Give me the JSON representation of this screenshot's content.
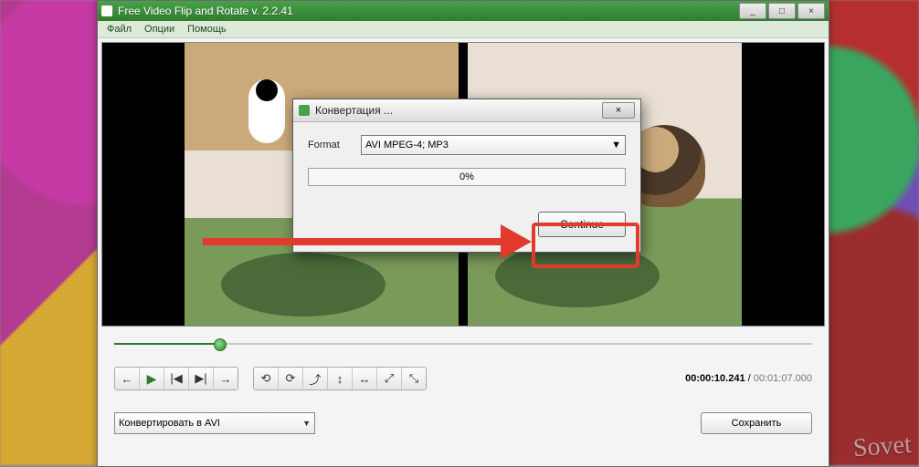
{
  "window": {
    "title": "Free Video Flip and Rotate v. 2.2.41",
    "min": "_",
    "max": "□",
    "close": "×"
  },
  "menu": {
    "file": "Файл",
    "options": "Опции",
    "help": "Помощь"
  },
  "transport": {
    "back": "←",
    "play": "▶",
    "prev": "|◀",
    "next": "▶|",
    "fwd": "→"
  },
  "rotate": {
    "b1": "⟲",
    "b2": "⟳",
    "b3": "⤴",
    "b4": "↕",
    "b5": "↔",
    "b6": "⤢",
    "b7": "⤡"
  },
  "time": {
    "current": "00:00:10.241",
    "sep": "/",
    "total": "00:01:07.000"
  },
  "convert": {
    "combo": "Конвертировать в AVI",
    "save": "Сохранить"
  },
  "dialog": {
    "title": "Конвертация ...",
    "format_label": "Format",
    "format_value": "AVI MPEG-4; MP3",
    "progress": "0%",
    "continue": "Continue",
    "close": "×"
  },
  "watermark": "Sovet"
}
